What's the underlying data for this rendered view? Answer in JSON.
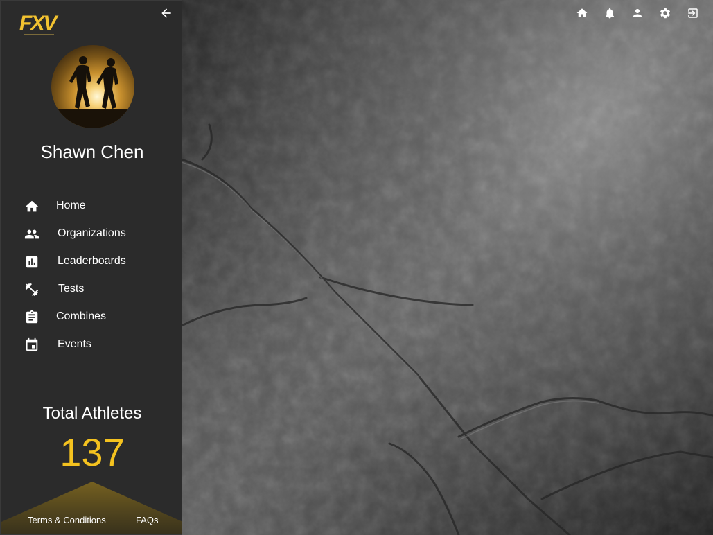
{
  "brand": {
    "logo_text": "FXV",
    "accent": "#f4c21f"
  },
  "sidebar": {
    "collapse_icon": "arrow-left-icon",
    "user": {
      "name": "Shawn Chen",
      "avatar": "runners-silhouette-avatar"
    },
    "nav": [
      {
        "label": "Home",
        "icon": "home-icon"
      },
      {
        "label": "Organizations",
        "icon": "people-icon"
      },
      {
        "label": "Leaderboards",
        "icon": "bar-chart-icon"
      },
      {
        "label": "Tests",
        "icon": "dumbbell-icon"
      },
      {
        "label": "Combines",
        "icon": "clipboard-icon"
      },
      {
        "label": "Events",
        "icon": "calendar-icon"
      }
    ],
    "stats": {
      "title": "Total Athletes",
      "value": "137"
    },
    "footer": {
      "terms": "Terms & Conditions",
      "faqs": "FAQs"
    }
  },
  "topbar": {
    "icons": [
      "home-icon",
      "bell-icon",
      "person-icon",
      "gear-icon",
      "logout-icon"
    ]
  }
}
